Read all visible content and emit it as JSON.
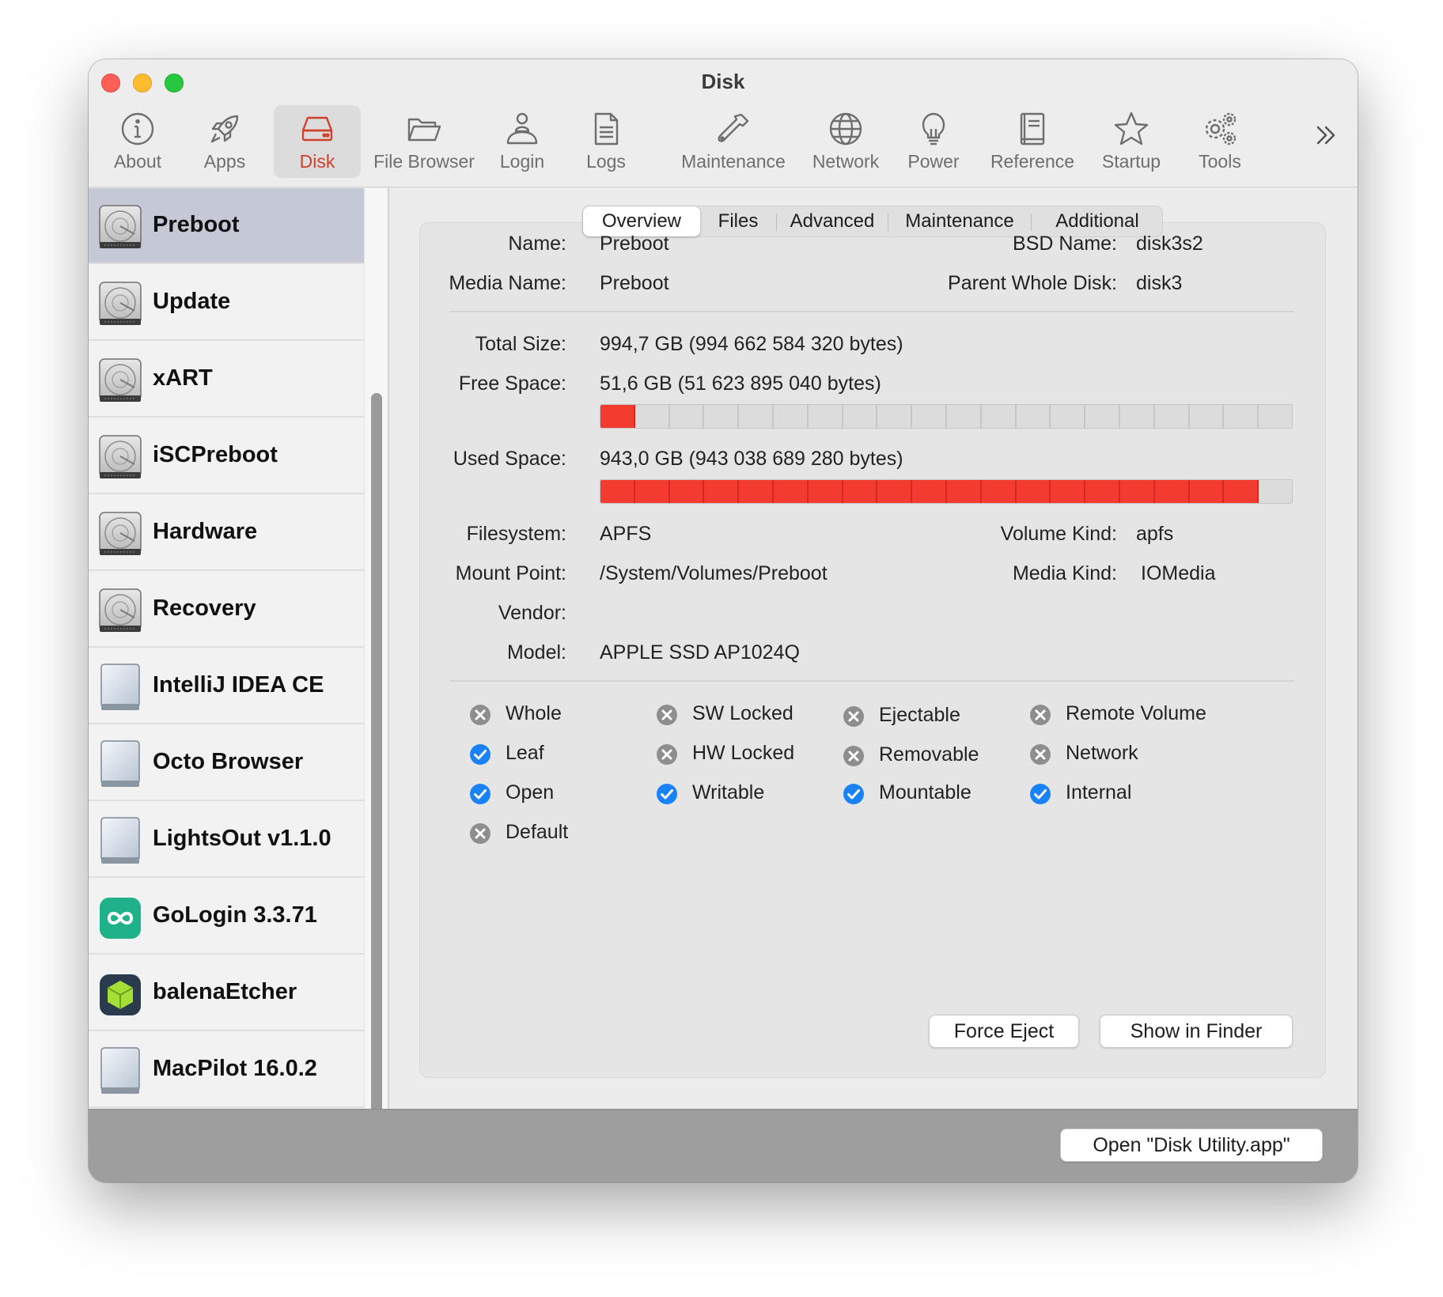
{
  "window": {
    "title": "Disk"
  },
  "toolbar": {
    "items": [
      {
        "label": "About",
        "icon": "info-icon"
      },
      {
        "label": "Apps",
        "icon": "rocket-icon"
      },
      {
        "label": "Disk",
        "icon": "disk-icon",
        "active": true
      },
      {
        "label": "File Browser",
        "icon": "folder-icon"
      },
      {
        "label": "Login",
        "icon": "user-icon"
      },
      {
        "label": "Logs",
        "icon": "log-document-icon"
      },
      {
        "label": "Maintenance",
        "icon": "wrench-icon"
      },
      {
        "label": "Network",
        "icon": "globe-icon"
      },
      {
        "label": "Power",
        "icon": "lightbulb-icon"
      },
      {
        "label": "Reference",
        "icon": "book-icon"
      },
      {
        "label": "Startup",
        "icon": "star-icon"
      },
      {
        "label": "Tools",
        "icon": "gears-icon"
      }
    ],
    "more_icon": "chevron-double-right-icon",
    "accent_color": "#d0412c"
  },
  "sidebar": {
    "items": [
      {
        "label": "Preboot",
        "icon": "hard-drive-icon",
        "selected": true
      },
      {
        "label": "Update",
        "icon": "hard-drive-icon"
      },
      {
        "label": "xART",
        "icon": "hard-drive-icon"
      },
      {
        "label": "iSCPreboot",
        "icon": "hard-drive-icon"
      },
      {
        "label": "Hardware",
        "icon": "hard-drive-icon"
      },
      {
        "label": "Recovery",
        "icon": "hard-drive-icon"
      },
      {
        "label": "IntelliJ IDEA CE",
        "icon": "external-volume-icon"
      },
      {
        "label": "Octo Browser",
        "icon": "external-volume-icon"
      },
      {
        "label": "LightsOut v1.1.0",
        "icon": "external-volume-icon"
      },
      {
        "label": "GoLogin 3.3.71",
        "icon": "gologin-app-icon"
      },
      {
        "label": "balenaEtcher",
        "icon": "balena-cube-icon"
      },
      {
        "label": "MacPilot 16.0.2",
        "icon": "external-volume-icon"
      }
    ]
  },
  "tabs": {
    "items": [
      "Overview",
      "Files",
      "Advanced",
      "Maintenance",
      "Additional"
    ],
    "active": "Overview"
  },
  "overview": {
    "name_label": "Name:",
    "name": "Preboot",
    "bsd_label": "BSD Name:",
    "bsd": "disk3s2",
    "media_name_label": "Media Name:",
    "media_name": "Preboot",
    "parent_label": "Parent Whole Disk:",
    "parent": "disk3",
    "total_label": "Total Size:",
    "total": "994,7 GB (994 662 584 320 bytes)",
    "free_label": "Free Space:",
    "free": "51,6 GB (51 623 895 040 bytes)",
    "free_fraction": 0.052,
    "used_label": "Used Space:",
    "used": "943,0 GB (943 038 689 280 bytes)",
    "used_fraction": 0.948,
    "filesystem_label": "Filesystem:",
    "filesystem": "APFS",
    "volume_kind_label": "Volume Kind:",
    "volume_kind": "apfs",
    "mount_label": "Mount Point:",
    "mount": "/System/Volumes/Preboot",
    "media_kind_label": "Media Kind:",
    "media_kind": "IOMedia",
    "vendor_label": "Vendor:",
    "vendor": "",
    "model_label": "Model:",
    "model": "APPLE SSD AP1024Q",
    "bar_fill_color": "#f33b30"
  },
  "flags": [
    {
      "label": "Whole",
      "checked": false
    },
    {
      "label": "SW Locked",
      "checked": false
    },
    {
      "label": "Ejectable",
      "checked": false
    },
    {
      "label": "Remote Volume",
      "checked": false
    },
    {
      "label": "Leaf",
      "checked": true
    },
    {
      "label": "HW Locked",
      "checked": false
    },
    {
      "label": "Removable",
      "checked": false
    },
    {
      "label": "Network",
      "checked": false
    },
    {
      "label": "Open",
      "checked": true
    },
    {
      "label": "Writable",
      "checked": true
    },
    {
      "label": "Mountable",
      "checked": true
    },
    {
      "label": "Internal",
      "checked": true
    },
    {
      "label": "Default",
      "checked": false
    }
  ],
  "buttons": {
    "force_eject": "Force Eject",
    "show_in_finder": "Show in Finder",
    "open_disk_utility": "Open \"Disk Utility.app\""
  },
  "colors": {
    "check_on": "#1a82f7",
    "check_off": "#8e8e8e"
  }
}
